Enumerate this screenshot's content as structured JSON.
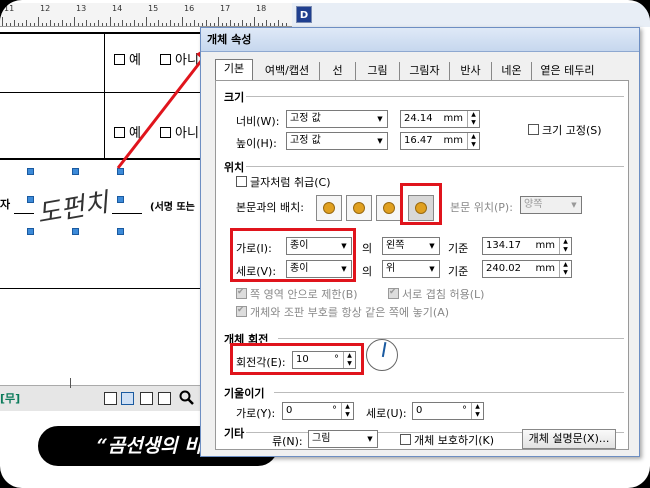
{
  "ruler": {
    "numbers": [
      "11",
      "12",
      "13",
      "14",
      "15",
      "16",
      "17",
      "18"
    ],
    "d_button": "D"
  },
  "document": {
    "row1_options": [
      "예",
      "아니"
    ],
    "row2_options": [
      "예",
      "아니"
    ],
    "left_label": "자",
    "signature_text": "도펀치",
    "sign_label": "(서명 또는",
    "status_text": "[무]",
    "caption": "“곰선생의 비밀"
  },
  "dialog": {
    "title": "개체 속성",
    "tabs": [
      "기본",
      "여백/캡션",
      "선",
      "그림",
      "그림자",
      "반사",
      "네온",
      "옅은 테두리"
    ],
    "size": {
      "section": "크기",
      "width_label": "너비(W):",
      "width_mode": "고정 값",
      "width_value": "24.14",
      "width_unit": "mm",
      "height_label": "높이(H):",
      "height_mode": "고정 값",
      "height_value": "16.47",
      "height_unit": "mm",
      "fix_size_label": "크기 고정(S)"
    },
    "position": {
      "section": "위치",
      "treat_as_char_label": "글자처럼 취급(C)",
      "layout_label": "본문과의 배치:",
      "body_position_label": "본문 위치(P):",
      "body_position_value": "양쪽",
      "horizontal_label": "가로(I):",
      "horizontal_ref": "종이",
      "horizontal_mid": "의",
      "horizontal_align": "왼쪽",
      "horizontal_base": "기준",
      "horizontal_value": "134.17",
      "horizontal_unit": "mm",
      "vertical_label": "세로(V):",
      "vertical_ref": "종이",
      "vertical_mid": "의",
      "vertical_align": "위",
      "vertical_base": "기준",
      "vertical_value": "240.02",
      "vertical_unit": "mm",
      "limit_label": "쪽 영역 안으로 제한(B)",
      "overlap_label": "서로 겹침 허용(L)",
      "same_page_label": "개체와 조판 부호를 항상 같은 쪽에 놓기(A)"
    },
    "rotation": {
      "section": "개체 회전",
      "angle_label": "회전각(E):",
      "angle_value": "10",
      "angle_unit": "°"
    },
    "skew": {
      "section": "기울이기",
      "horizontal_label": "가로(Y):",
      "horizontal_value": "0",
      "horizontal_unit": "°",
      "vertical_label": "세로(U):",
      "vertical_value": "0",
      "vertical_unit": "°"
    },
    "other": {
      "section": "기타",
      "kind_label": "류(N):",
      "kind_value": "그림",
      "protect_label": "개체 보호하기(K)",
      "description_button": "개체 설명문(X)..."
    }
  },
  "colors": {
    "highlight": "#e0141c",
    "title_bar": "#c6d7ee",
    "selection_handle": "#3c8ad8"
  }
}
